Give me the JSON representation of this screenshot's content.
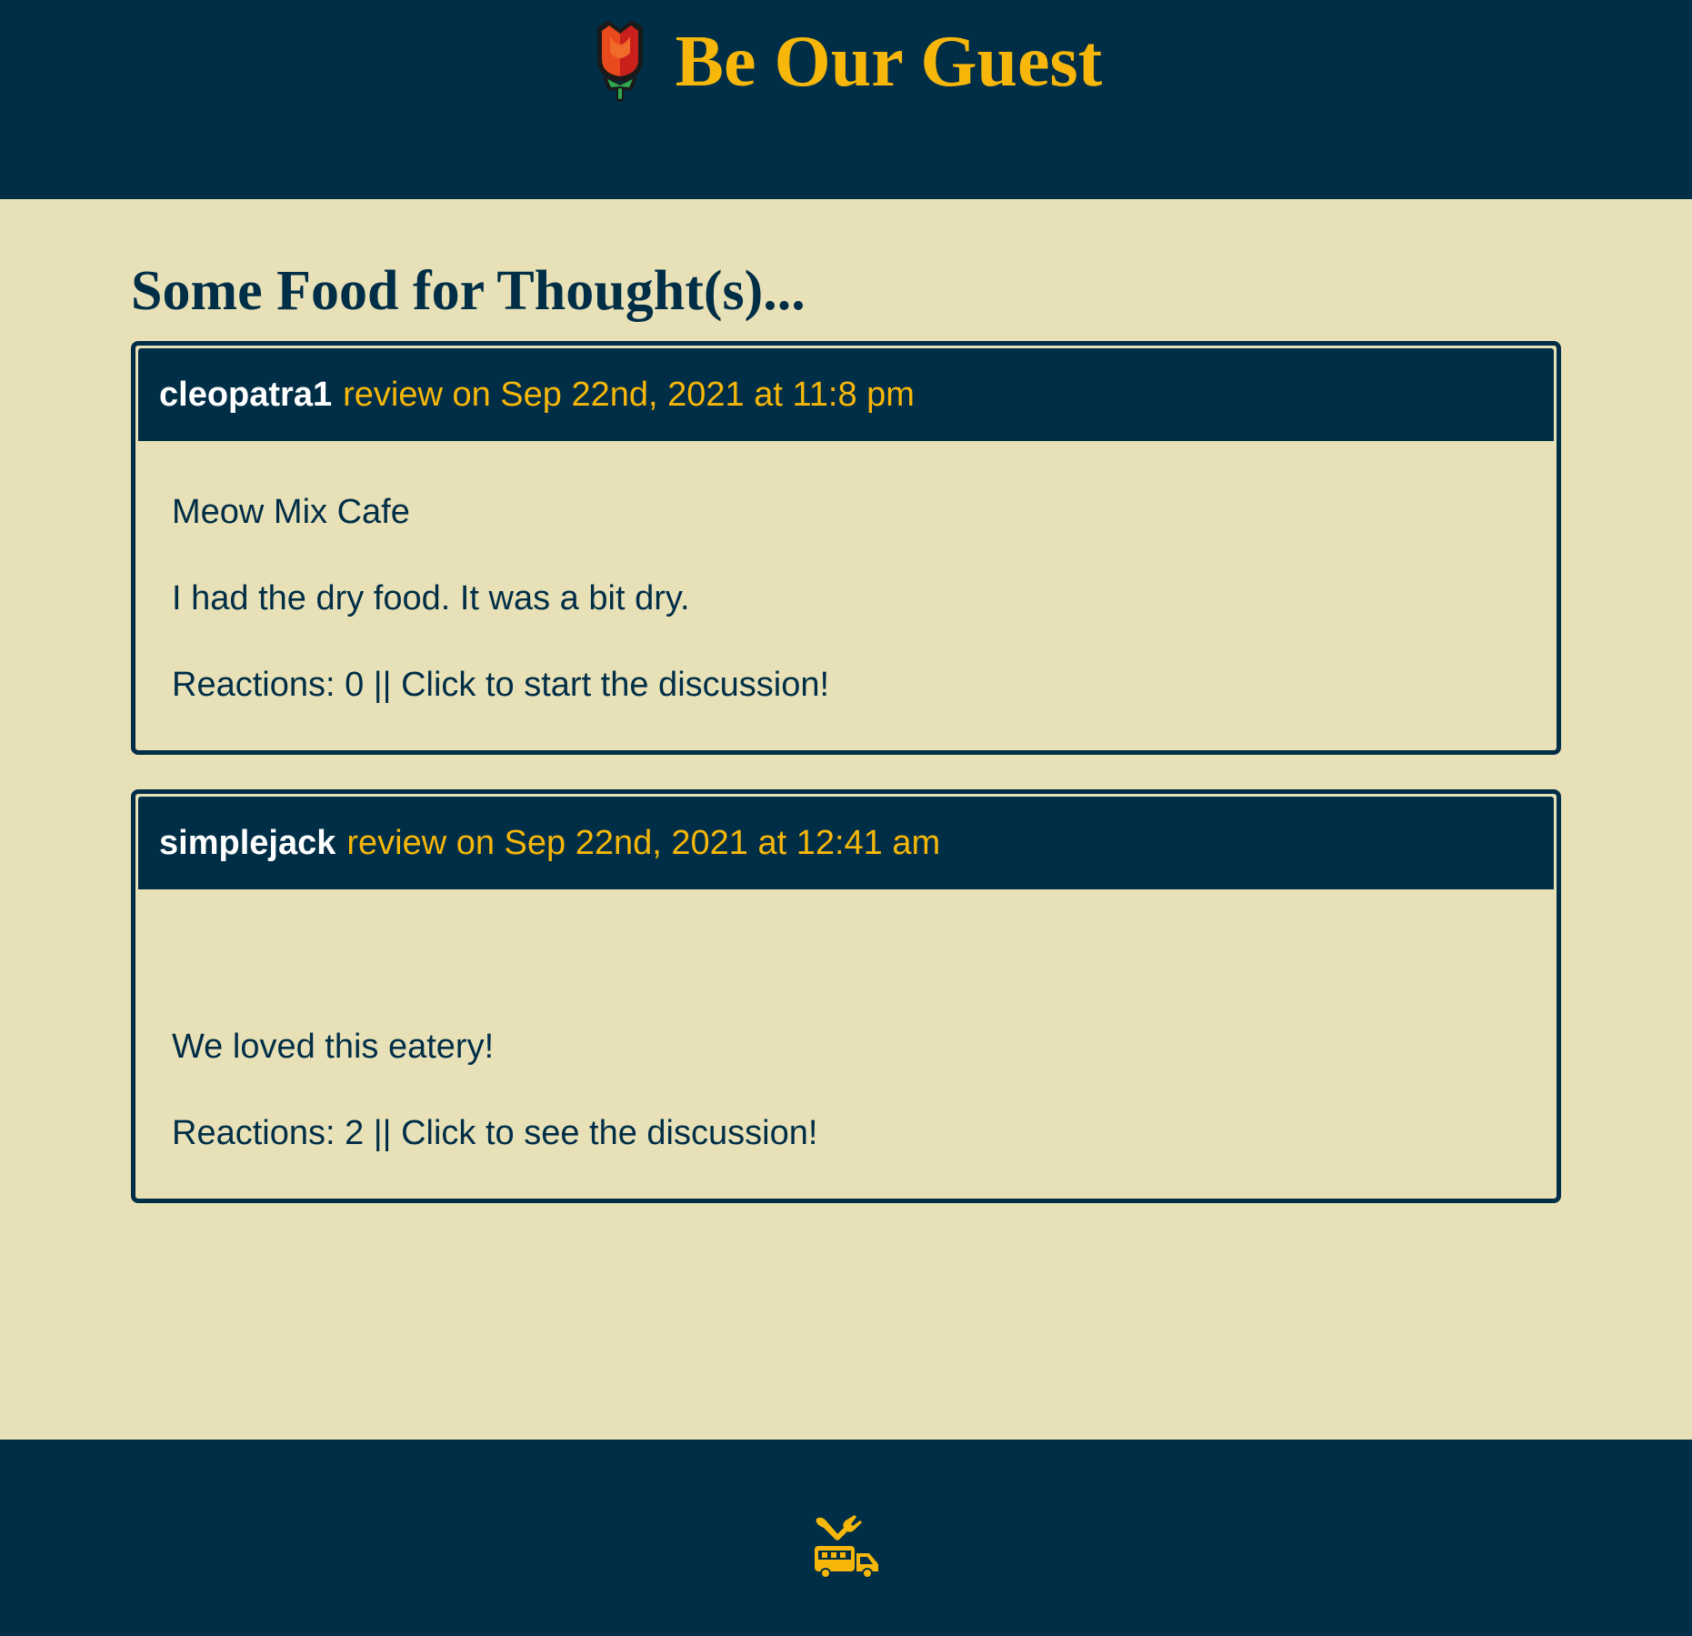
{
  "header": {
    "title": "Be Our Guest",
    "logo_icon": "rose-icon"
  },
  "main": {
    "heading": "Some Food for Thought(s)..."
  },
  "reviews": [
    {
      "username": "cleopatra1",
      "meta": "review on Sep 22nd, 2021 at 11:8 pm",
      "restaurant": "Meow Mix Cafe",
      "text": "I had the dry food. It was a bit dry.",
      "reactions": "Reactions: 0 || Click to start the discussion!"
    },
    {
      "username": "simplejack",
      "meta": "review on Sep 22nd, 2021 at 12:41 am",
      "restaurant": "",
      "text": "We loved this eatery!",
      "reactions": "Reactions: 2 || Click to see the discussion!"
    }
  ],
  "footer": {
    "icon": "food-truck-icon"
  },
  "colors": {
    "navy": "#002e47",
    "gold": "#f6b70a",
    "cream": "#e8e1b7"
  }
}
